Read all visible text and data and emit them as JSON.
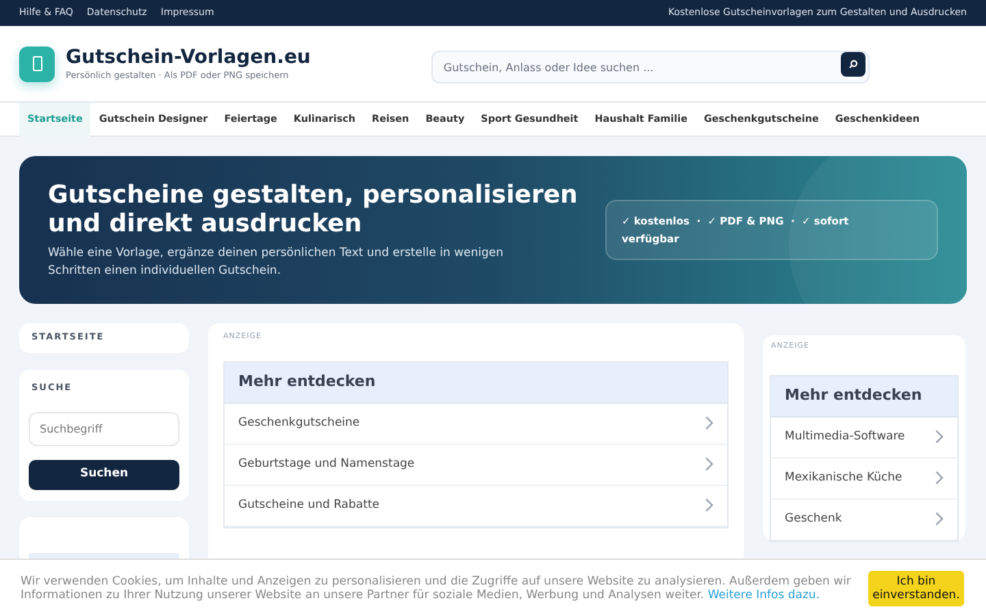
{
  "topbar": {
    "links": [
      "Hilfe & FAQ",
      "Datenschutz",
      "Impressum"
    ],
    "tagline": "Kostenlose Gutscheinvorlagen zum Gestalten und Ausdrucken"
  },
  "header": {
    "site_name": "Gutschein-Vorlagen.eu",
    "subtitle": "Persönlich gestalten · Als PDF oder PNG speichern",
    "search": {
      "placeholder": "Gutschein, Anlass oder Idee suchen ..."
    }
  },
  "nav": [
    {
      "label": "Startseite",
      "selected": true
    },
    {
      "label": "Gutschein Designer",
      "selected": false
    },
    {
      "label": "Feiertage",
      "selected": false
    },
    {
      "label": "Kulinarisch",
      "selected": false
    },
    {
      "label": "Reisen",
      "selected": false
    },
    {
      "label": "Beauty",
      "selected": false
    },
    {
      "label": "Sport Gesundheit",
      "selected": false
    },
    {
      "label": "Haushalt Familie",
      "selected": false
    },
    {
      "label": "Geschenkgutscheine",
      "selected": false
    },
    {
      "label": "Geschenkideen",
      "selected": false
    }
  ],
  "hero": {
    "title": "Gutscheine gestalten, personalisieren und direkt ausdrucken",
    "text": "Wähle eine Vorlage, ergänze deinen persönlichen Text und erstelle in wenigen Schritten einen individuellen Gutschein.",
    "features": "✓ kostenlos  ·  ✓ PDF & PNG  ·  ✓ sofort verfügbar"
  },
  "sidebar": {
    "home": "STARTSEITE",
    "search_title": "SUCHE",
    "search": {
      "placeholder": "Suchbegriff"
    },
    "search_button": "Suchen"
  },
  "main_ad": {
    "label": "ANZEIGE",
    "title": "Mehr entdecken",
    "items": [
      "Geschenkgutscheine",
      "Geburtstage und Namenstage",
      "Gutscheine und Rabatte"
    ]
  },
  "right_ad": {
    "label": "ANZEIGE",
    "title": "Mehr entdecken",
    "items": [
      "Multimedia-Software",
      "Mexikanische Küche",
      "Geschenk"
    ]
  },
  "cookie": {
    "text": "Wir verwenden Cookies, um Inhalte und Anzeigen zu personalisieren und die Zugriffe auf unsere Website zu analysieren. Außerdem geben wir Informationen zu Ihrer Nutzung unserer Website an unsere Partner für soziale Medien, Werbung und Analysen weiter.",
    "link": "Weitere Infos dazu.",
    "button": "Ich bin einverstanden."
  }
}
